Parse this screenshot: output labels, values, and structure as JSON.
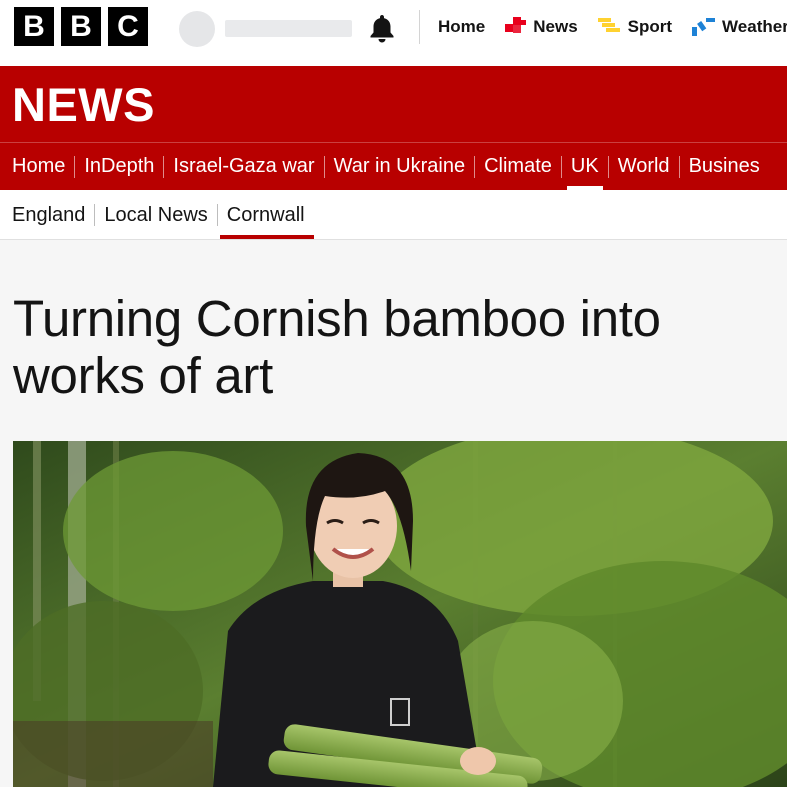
{
  "brand": {
    "logo_letters": [
      "B",
      "B",
      "C"
    ],
    "section_wordmark": "NEWS"
  },
  "colors": {
    "brand_red": "#b80000",
    "news_icon": "#e8001c",
    "sport_icon": "#ffd230",
    "weather_icon": "#1e82d6"
  },
  "account": {
    "avatar": "avatar-placeholder",
    "notification_icon": "bell-icon"
  },
  "top_nav": [
    {
      "label": "Home",
      "icon": ""
    },
    {
      "label": "News",
      "icon": "news-icon"
    },
    {
      "label": "Sport",
      "icon": "sport-icon"
    },
    {
      "label": "Weather",
      "icon": "weather-icon"
    }
  ],
  "main_nav": [
    {
      "label": "Home",
      "active": false
    },
    {
      "label": "InDepth",
      "active": false
    },
    {
      "label": "Israel-Gaza war",
      "active": false
    },
    {
      "label": "War in Ukraine",
      "active": false
    },
    {
      "label": "Climate",
      "active": false
    },
    {
      "label": "UK",
      "active": true
    },
    {
      "label": "World",
      "active": false
    },
    {
      "label": "Busines",
      "active": false
    }
  ],
  "sub_nav": [
    {
      "label": "England",
      "active": false
    },
    {
      "label": "Local News",
      "active": false
    },
    {
      "label": "Cornwall",
      "active": true
    }
  ],
  "article": {
    "headline_line1": "Turning Cornish bamboo into",
    "headline_line2": "works of art",
    "image_subject": "woman-holding-bamboo-photo"
  }
}
